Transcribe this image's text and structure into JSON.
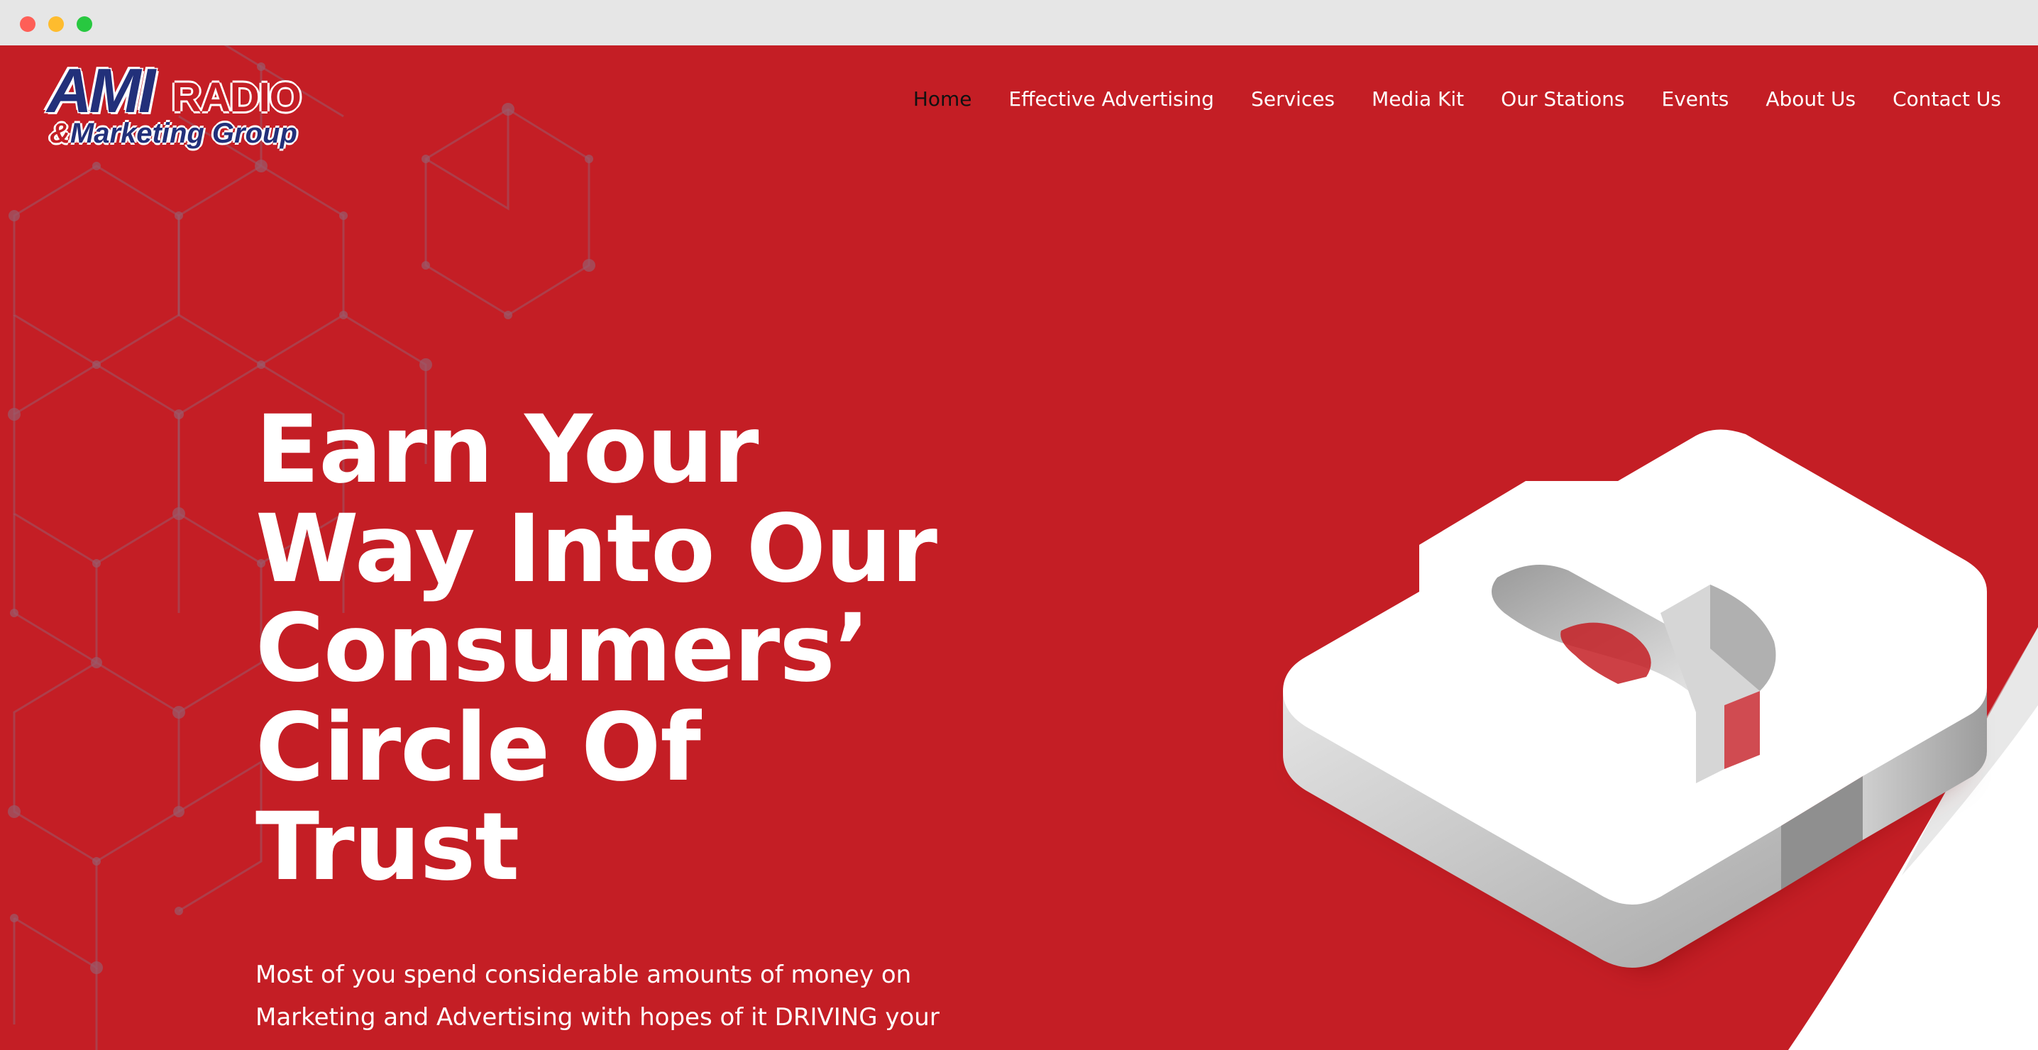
{
  "logo": {
    "ami": "AMI",
    "radio": "RADIO",
    "sub_amp": "&",
    "sub_text": "Marketing Group"
  },
  "nav": {
    "items": [
      {
        "label": "Home",
        "active": true
      },
      {
        "label": "Effective Advertising",
        "active": false
      },
      {
        "label": "Services",
        "active": false
      },
      {
        "label": "Media Kit",
        "active": false
      },
      {
        "label": "Our Stations",
        "active": false
      },
      {
        "label": "Events",
        "active": false
      },
      {
        "label": "About Us",
        "active": false
      },
      {
        "label": "Contact Us",
        "active": false
      }
    ]
  },
  "hero": {
    "title_lines": [
      "Earn Your",
      "Way Into Our",
      "Consumers’",
      "Circle Of",
      "Trust"
    ],
    "text": "Most of you spend considerable amounts of money on Marketing and Advertising with hopes of it DRIVING your"
  },
  "colors": {
    "brand_red": "#c41e25",
    "brand_blue": "#22307a",
    "nav_active": "#111111"
  },
  "icons": {
    "hero_graphic": "3d-puzzle-piece-icon",
    "background": "hexagon-network-pattern"
  }
}
